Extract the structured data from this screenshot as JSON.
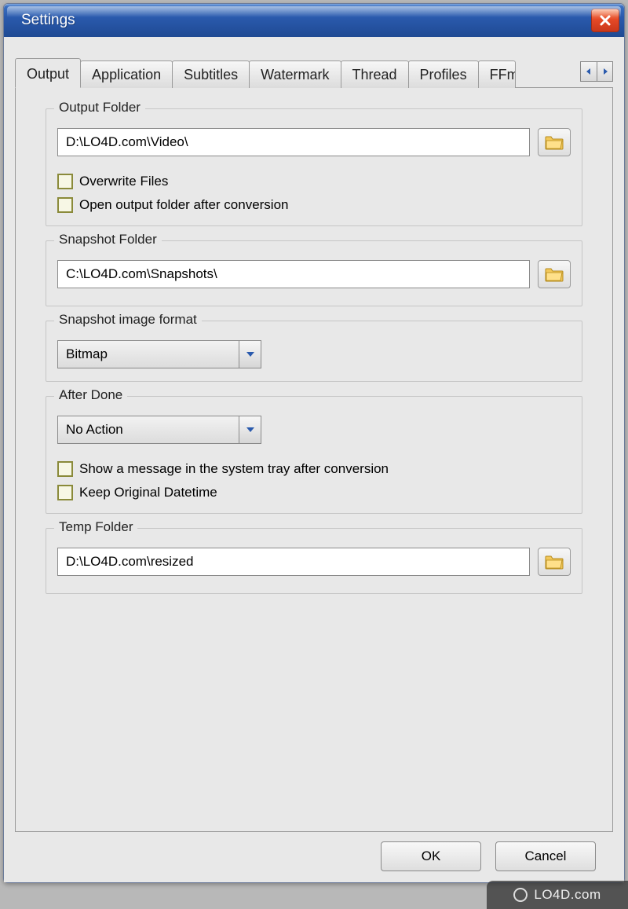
{
  "window": {
    "title": "Settings"
  },
  "tabs": [
    {
      "label": "Output"
    },
    {
      "label": "Application"
    },
    {
      "label": "Subtitles"
    },
    {
      "label": "Watermark"
    },
    {
      "label": "Thread"
    },
    {
      "label": "Profiles"
    },
    {
      "label": "FFm"
    }
  ],
  "outputFolder": {
    "legend": "Output Folder",
    "path": "D:\\LO4D.com\\Video\\",
    "overwrite_label": "Overwrite Files",
    "openAfter_label": "Open output folder after conversion"
  },
  "snapshotFolder": {
    "legend": "Snapshot Folder",
    "path": "C:\\LO4D.com\\Snapshots\\"
  },
  "snapshotFormat": {
    "legend": "Snapshot image format",
    "selected": "Bitmap"
  },
  "afterDone": {
    "legend": "After Done",
    "selected": "No Action",
    "showMessage_label": "Show a message in the system tray after conversion",
    "keepDatetime_label": "Keep Original Datetime"
  },
  "tempFolder": {
    "legend": "Temp Folder",
    "path": "D:\\LO4D.com\\resized"
  },
  "buttons": {
    "ok": "OK",
    "cancel": "Cancel"
  },
  "watermark": "LO4D.com"
}
